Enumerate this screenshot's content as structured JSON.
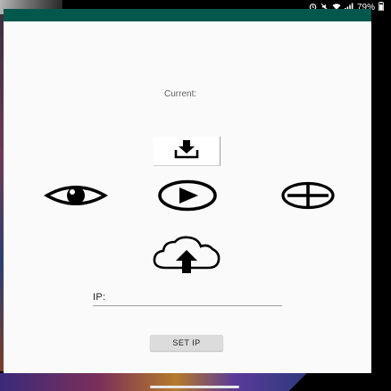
{
  "status_bar": {
    "icons": [
      "alarm-icon",
      "mute-icon",
      "wifi-icon",
      "signal-icon"
    ],
    "battery_text": "79%"
  },
  "app": {
    "header_color": "#00574b",
    "current_label": "Current:",
    "buttons": {
      "download_icon": "download-icon",
      "eye_icon": "eye-icon",
      "play_icon": "play-circle-icon",
      "add_icon": "plus-circle-icon",
      "upload_icon": "cloud-upload-icon"
    },
    "ip": {
      "label": "IP:",
      "value": ""
    },
    "set_ip_label": "SET IP"
  }
}
